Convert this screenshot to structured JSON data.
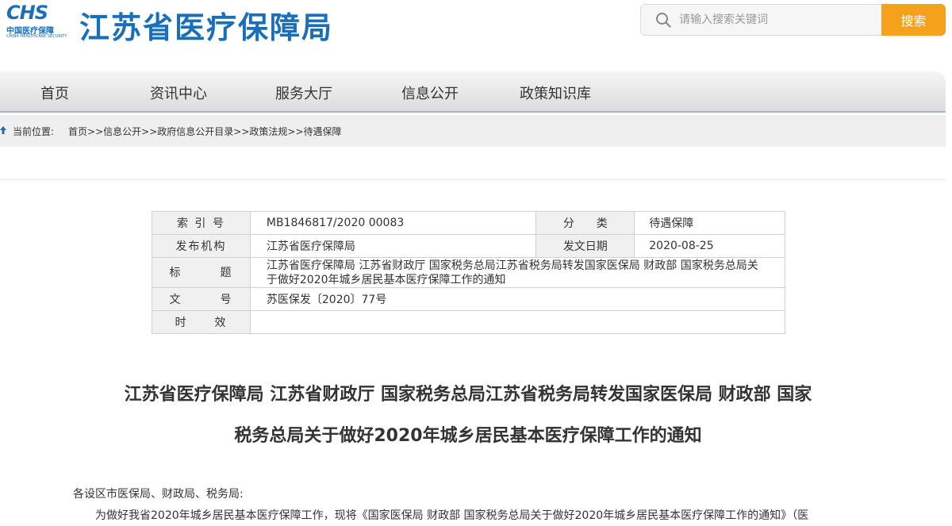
{
  "header": {
    "logo_mark": "CHS",
    "logo_cn": "中国医疗保障",
    "logo_en": "CHINA HEALTHCARE SECURITY",
    "site_title": "江苏省医疗保障局",
    "search_placeholder": "请输入搜索关键词",
    "search_button": "搜索"
  },
  "nav": {
    "items": [
      {
        "label": "首页"
      },
      {
        "label": "资讯中心"
      },
      {
        "label": "服务大厅"
      },
      {
        "label": "信息公开"
      },
      {
        "label": "政策知识库"
      }
    ]
  },
  "breadcrumb": {
    "label": "当前位置:",
    "items": [
      "首页",
      "信息公开",
      "政府信息公开目录",
      "政策法规",
      "待遇保障"
    ],
    "separator": ">>"
  },
  "meta": {
    "index_label": "索 引 号",
    "index_value": "MB1846817/2020 00083",
    "category_label": "分类",
    "category_value": "待遇保障",
    "publisher_label": "发布机构",
    "publisher_value": "江苏省医疗保障局",
    "date_label": "发文日期",
    "date_value": "2020-08-25",
    "title_label_a": "标",
    "title_label_b": "题",
    "title_value": "江苏省医疗保障局 江苏省财政厅 国家税务总局江苏省税务局转发国家医保局 财政部 国家税务总局关于做好2020年城乡居民基本医疗保障工作的通知",
    "docno_label_a": "文",
    "docno_label_b": "号",
    "docno_value": "苏医保发〔2020〕77号",
    "validity_label_a": "时",
    "validity_label_b": "效",
    "validity_value": ""
  },
  "article": {
    "title_line1": "江苏省医疗保障局 江苏省财政厅 国家税务总局江苏省税务局转发国家医保局 财政部 国家",
    "title_line2": "税务总局关于做好2020年城乡居民基本医疗保障工作的通知",
    "salutation": "各设区市医保局、财政局、税务局:",
    "para1": "为做好我省2020年城乡居民基本医疗保障工作，现将《国家医保局 财政部 国家税务总局关于做好2020年城乡居民基本医疗保障工作的通知》（医"
  },
  "colors": {
    "brand_blue": "#1a6fb8",
    "search_orange": "#f5a11c"
  }
}
